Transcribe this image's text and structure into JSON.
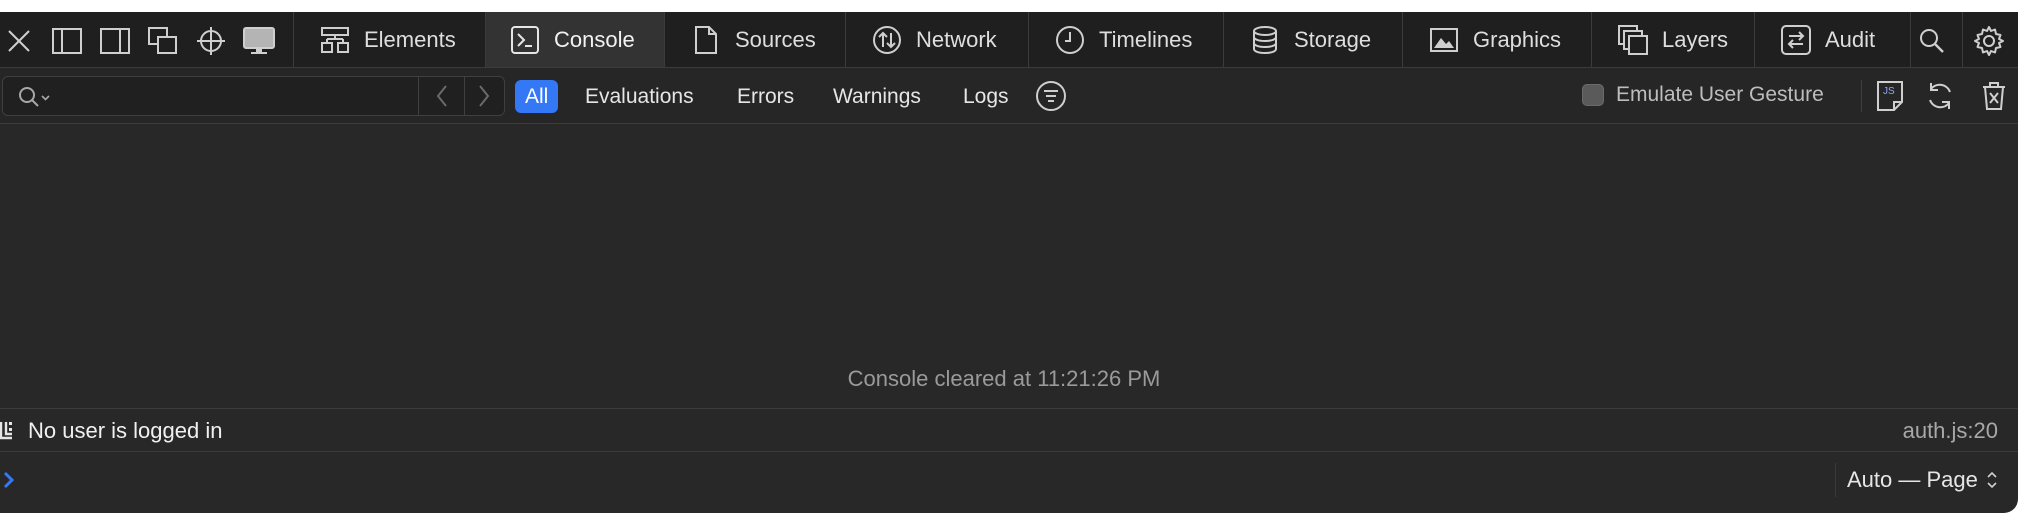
{
  "toolbar": {
    "icons": [
      "close-icon",
      "dock-left-icon",
      "dock-right-icon",
      "detach-window-icon",
      "element-picker-icon",
      "device-preview-icon"
    ],
    "tabs": [
      {
        "label": "Elements",
        "icon": "elements-icon"
      },
      {
        "label": "Console",
        "icon": "console-icon",
        "active": true
      },
      {
        "label": "Sources",
        "icon": "document-icon"
      },
      {
        "label": "Network",
        "icon": "network-icon"
      },
      {
        "label": "Timelines",
        "icon": "clock-icon"
      },
      {
        "label": "Storage",
        "icon": "database-icon"
      },
      {
        "label": "Graphics",
        "icon": "image-icon"
      },
      {
        "label": "Layers",
        "icon": "layers-icon"
      },
      {
        "label": "Audit",
        "icon": "audit-icon"
      }
    ],
    "right_icons": [
      "search-icon",
      "gear-icon"
    ]
  },
  "filter": {
    "search_value": "",
    "search_placeholder": "",
    "buttons": [
      "All",
      "Evaluations",
      "Errors",
      "Warnings",
      "Logs"
    ],
    "active_button": "All",
    "emulate_label": "Emulate User Gesture",
    "emulate_checked": false
  },
  "console": {
    "cleared_message": "Console cleared at 11:21:26 PM",
    "messages": [
      {
        "text": "No user is logged in",
        "source": "auth.js:20"
      }
    ],
    "prompt_value": "",
    "context_label": "Auto — Page"
  },
  "colors": {
    "background": "#282828",
    "toolbar": "#1f1f1f",
    "accent": "#3478f6",
    "text": "#e6e6e6",
    "muted": "#9a9a9a"
  }
}
